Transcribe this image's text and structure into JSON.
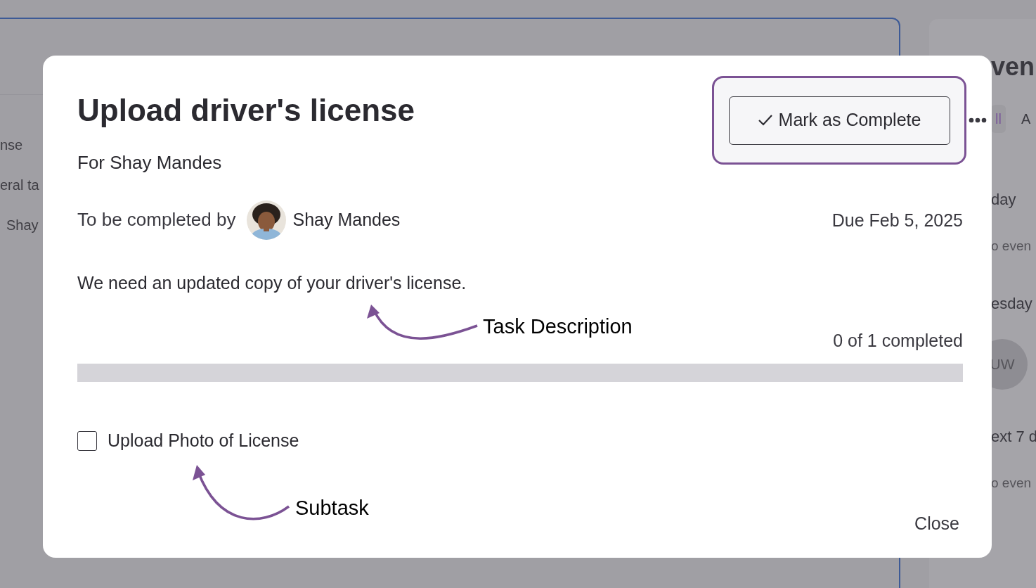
{
  "background_left": {
    "items": [
      "nse",
      "eral ta",
      "Shay"
    ]
  },
  "background_right": {
    "heading": "ven",
    "tabs": [
      {
        "label": "ll",
        "selected": true
      },
      {
        "label": "A",
        "selected": false
      }
    ],
    "sections": [
      {
        "title": "day",
        "kind": "empty",
        "text": "o even"
      },
      {
        "title": "esday",
        "kind": "avatar",
        "text": "UW"
      },
      {
        "title": "ext 7 d",
        "kind": "empty",
        "text": "o even"
      }
    ]
  },
  "modal": {
    "title": "Upload driver's license",
    "subtitle": "For Shay Mandes",
    "assignee_label": "To be completed by",
    "assignee_name": "Shay Mandes",
    "due": "Due Feb 5, 2025",
    "description": "We need an updated copy of your driver's license.",
    "progress_text": "0 of 1 completed",
    "progress": {
      "level": 0
    },
    "subtasks": [
      {
        "label": "Upload Photo of License",
        "checked": false
      }
    ],
    "complete_button": "Mark as Complete",
    "close_button": "Close"
  },
  "annotations": [
    {
      "label": "Task Description"
    },
    {
      "label": "Subtask"
    }
  ]
}
